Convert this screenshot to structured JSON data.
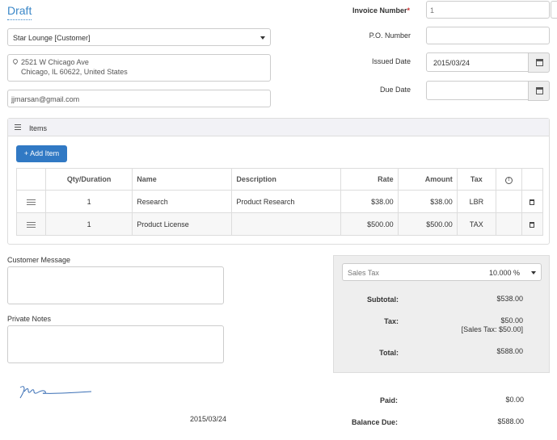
{
  "header": {
    "title": "Draft"
  },
  "customer": {
    "selected": "Star Lounge [Customer]",
    "address_line1": "2521 W Chicago Ave",
    "address_line2": "Chicago, IL 60622, United States",
    "email": "jjmarsan@gmail.com"
  },
  "invoice": {
    "number_label": "Invoice Number",
    "required_mark": "*",
    "number_value": "1",
    "po_label": "P.O. Number",
    "po_value": "",
    "issued_label": "Issued Date",
    "issued_value": "2015/03/24",
    "due_label": "Due Date",
    "due_value": ""
  },
  "items": {
    "panel_title": "Items",
    "add_label": "+ Add Item",
    "columns": [
      "Qty/Duration",
      "Name",
      "Description",
      "Rate",
      "Amount",
      "Tax"
    ],
    "rows": [
      {
        "qty": "1",
        "name": "Research",
        "description": "Product Research",
        "rate": "$38.00",
        "amount": "$38.00",
        "tax": "LBR"
      },
      {
        "qty": "1",
        "name": "Product License",
        "description": "",
        "rate": "$500.00",
        "amount": "$500.00",
        "tax": "TAX"
      }
    ]
  },
  "notes": {
    "customer_message_label": "Customer Message",
    "private_notes_label": "Private Notes"
  },
  "signature": {
    "date": "2015/03/24"
  },
  "summary": {
    "tax_select_label": "Sales Tax",
    "tax_select_value": "10.000 %",
    "subtotal_label": "Subtotal:",
    "subtotal_value": "$538.00",
    "tax_label": "Tax:",
    "tax_value": "$50.00",
    "tax_detail": "[Sales Tax: $50.00]",
    "total_label": "Total:",
    "total_value": "$588.00",
    "paid_label": "Paid:",
    "paid_value": "$0.00",
    "balance_label": "Balance Due:",
    "balance_value": "$588.00"
  }
}
